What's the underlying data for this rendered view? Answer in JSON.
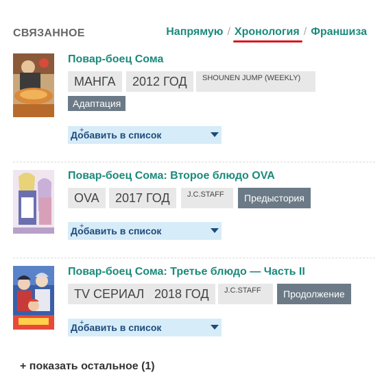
{
  "header": {
    "section_title": "СВЯЗАННОЕ",
    "tabs": [
      {
        "label": "Напрямую",
        "active": false
      },
      {
        "label": "Хронология",
        "active": true
      },
      {
        "label": "Франшиза",
        "active": false
      }
    ],
    "separator": "/"
  },
  "entries": [
    {
      "title": "Повар-боец Сома",
      "type": "МАНГА",
      "year": "2012 ГОД",
      "studio": "SHOUNEN JUMP (WEEKLY)",
      "relation": "Адаптация",
      "add_to_list": "Добавить в список"
    },
    {
      "title": "Повар-боец Сома: Второе блюдо OVA",
      "type": "OVA",
      "year": "2017 ГОД",
      "studio": "J.C.STAFF",
      "relation": "Предыстория",
      "add_to_list": "Добавить в список"
    },
    {
      "title": "Повар-боец Сома: Третье блюдо — Часть II",
      "type": "TV СЕРИАЛ",
      "year": "2018 ГОД",
      "studio": "J.C.STAFF",
      "relation": "Продолжение",
      "add_to_list": "Добавить в список"
    }
  ],
  "show_more": "+ показать остальное (1)",
  "colors": {
    "link": "#1a8a7a",
    "active_underline": "#d9141e",
    "tag_bg": "#e8e8e8",
    "relation_bg": "#6b7a86",
    "add_list_bg": "#d6ecf8"
  }
}
